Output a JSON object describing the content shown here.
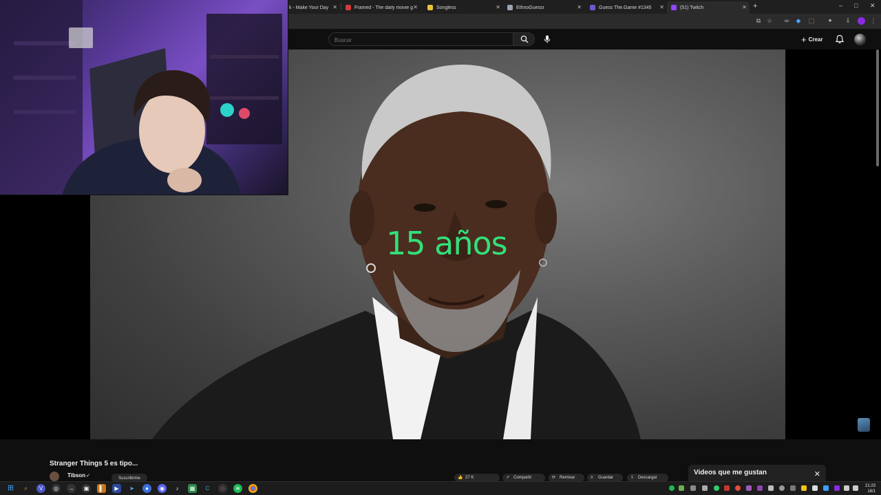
{
  "browser": {
    "tabs": [
      {
        "title": "k - Make Your Day",
        "favicon_color": "#444444"
      },
      {
        "title": "Framed - The daily movie guess",
        "favicon_color": "#d13b3b"
      },
      {
        "title": "Songless",
        "favicon_color": "#e8c33a"
      },
      {
        "title": "EthnoGuessr",
        "favicon_color": "#9aa4b0"
      },
      {
        "title": "Guess The.Game #1345",
        "favicon_color": "#6a5acd"
      },
      {
        "title": "(51) Twitch",
        "favicon_color": "#9146ff"
      }
    ],
    "new_tab_label": "+",
    "window_controls": {
      "minimize": "–",
      "maximize": "□",
      "close": "✕"
    }
  },
  "youtube": {
    "search": {
      "placeholder": "Buscar"
    },
    "create_label": "Crear",
    "icons": {
      "search": "search-icon",
      "mic": "mic-icon",
      "bell": "bell-icon"
    }
  },
  "video": {
    "overlay_text": "15 años"
  },
  "below_video": {
    "title": "Stranger Things 5 es tipo...",
    "channel": "Tibson",
    "subscribe_label": "Suscribirme",
    "actions": [
      {
        "label": "27 K",
        "icon": "like-icon"
      },
      {
        "label": "Compartir",
        "icon": "share-icon"
      },
      {
        "label": "Remixar",
        "icon": "remix-icon"
      },
      {
        "label": "Guardar",
        "icon": "save-icon"
      },
      {
        "label": "Descargar",
        "icon": "download-icon"
      }
    ]
  },
  "liked_panel": {
    "title": "Videos que me gustan",
    "close": "✕"
  },
  "taskbar": {
    "time": "21:23",
    "date": "18/1"
  },
  "colors": {
    "overlay_green": "#33e07a",
    "accent_purple": "#8a2be2"
  }
}
